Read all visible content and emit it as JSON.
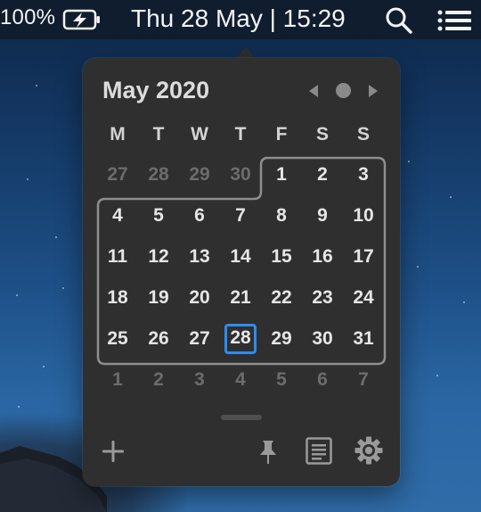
{
  "menubar": {
    "battery_percent": "100%",
    "battery_icon": "battery-charging-icon",
    "clock": "Thu 28 May | 15:29",
    "search_icon": "search-icon",
    "list_icon": "list-icon"
  },
  "calendar": {
    "title": "May 2020",
    "weekdays": [
      "M",
      "T",
      "W",
      "T",
      "F",
      "S",
      "S"
    ],
    "weeks": [
      [
        "27",
        "28",
        "29",
        "30",
        "1",
        "2",
        "3"
      ],
      [
        "4",
        "5",
        "6",
        "7",
        "8",
        "9",
        "10"
      ],
      [
        "11",
        "12",
        "13",
        "14",
        "15",
        "16",
        "17"
      ],
      [
        "18",
        "19",
        "20",
        "21",
        "22",
        "23",
        "24"
      ],
      [
        "25",
        "26",
        "27",
        "28",
        "29",
        "30",
        "31"
      ],
      [
        "1",
        "2",
        "3",
        "4",
        "5",
        "6",
        "7"
      ]
    ],
    "dimmed_cells": [
      "0-0",
      "0-1",
      "0-2",
      "0-3",
      "5-0",
      "5-1",
      "5-2",
      "5-3",
      "5-4",
      "5-5",
      "5-6"
    ],
    "today": "28",
    "colors": {
      "accent": "#2d8cf0",
      "background": "#2f2f30",
      "text": "#e6e6e6",
      "dim_text": "#6c6c6c"
    }
  },
  "toolbar": {
    "add_icon": "plus-icon",
    "pin_icon": "pin-icon",
    "notes_icon": "notes-icon",
    "settings_icon": "gear-icon"
  }
}
